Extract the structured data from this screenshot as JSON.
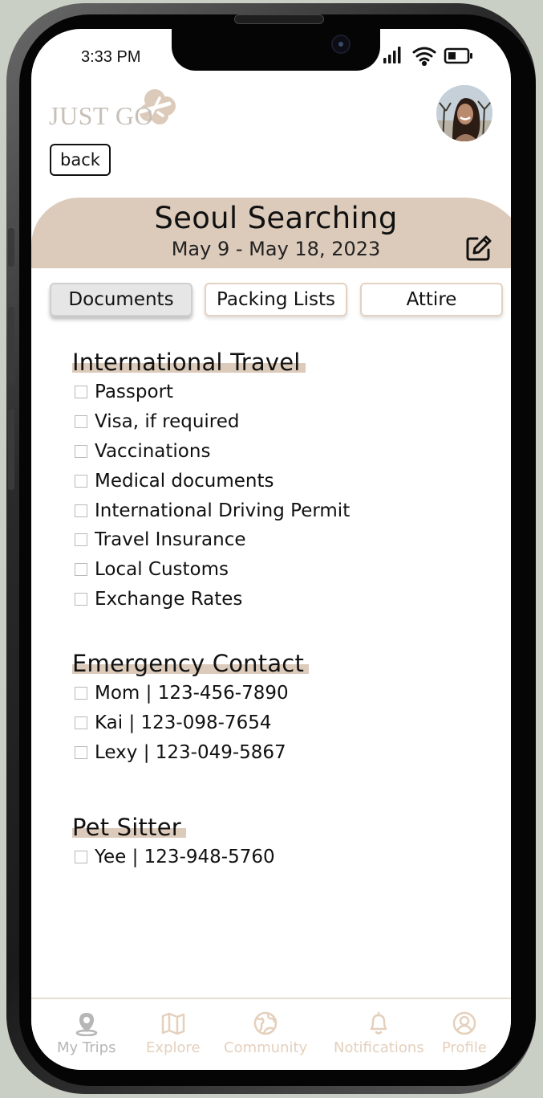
{
  "status_bar": {
    "time": "3:33 PM"
  },
  "header": {
    "logo_text": "JUST GO",
    "back_label": "back"
  },
  "trip": {
    "title": "Seoul Searching",
    "dates": "May 9 - May 18, 2023"
  },
  "tabs": [
    {
      "label": "Documents",
      "active": true
    },
    {
      "label": "Packing Lists",
      "active": false
    },
    {
      "label": "Attire",
      "active": false
    }
  ],
  "sections": [
    {
      "title": "International Travel",
      "items": [
        "Passport",
        "Visa, if required",
        "Vaccinations",
        "Medical documents",
        "International Driving Permit",
        "Travel Insurance",
        "Local Customs",
        "Exchange Rates"
      ]
    },
    {
      "title": "Emergency Contact",
      "items": [
        "Mom | 123-456-7890",
        "Kai | 123-098-7654",
        "Lexy | 123-049-5867"
      ]
    },
    {
      "title": "Pet Sitter",
      "items": [
        "Yee | 123-948-5760"
      ]
    }
  ],
  "bottom_nav": [
    {
      "label": "My Trips",
      "icon": "map-pin-icon",
      "active": true
    },
    {
      "label": "Explore",
      "icon": "map-icon",
      "active": false
    },
    {
      "label": "Community",
      "icon": "globe-icon",
      "active": false
    },
    {
      "label": "Notifications",
      "icon": "bell-icon",
      "active": false
    },
    {
      "label": "Profile",
      "icon": "user-circle-icon",
      "active": false
    }
  ],
  "colors": {
    "accent": "#dccbbb",
    "nav_active": "#b6b6b6",
    "nav_inactive": "#e4d0bd",
    "background": "#c9cfc4"
  }
}
